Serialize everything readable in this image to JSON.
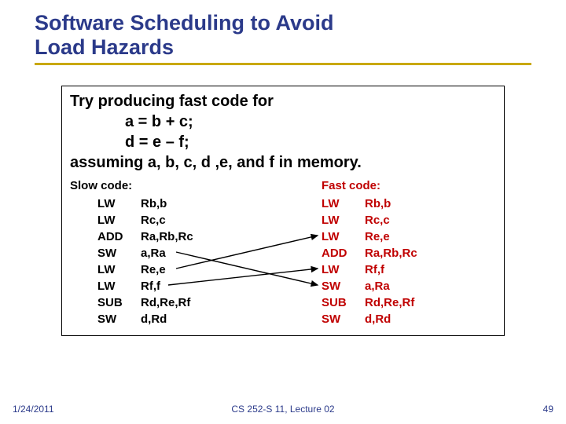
{
  "title_line1": "Software Scheduling to Avoid",
  "title_line2": "Load Hazards",
  "prompt": {
    "line1": "Try producing fast code for",
    "eq1": "a = b + c;",
    "eq2": "d = e – f;",
    "line2": "assuming a, b, c, d ,e, and f in memory."
  },
  "slow_label": "Slow code:",
  "fast_label": "Fast code:",
  "slow": [
    {
      "op": "LW",
      "arg": "Rb,b"
    },
    {
      "op": "LW",
      "arg": "Rc,c"
    },
    {
      "op": "ADD",
      "arg": "Ra,Rb,Rc"
    },
    {
      "op": "SW",
      "arg": "a,Ra"
    },
    {
      "op": "LW",
      "arg": "Re,e"
    },
    {
      "op": "LW",
      "arg": "Rf,f"
    },
    {
      "op": "SUB",
      "arg": "Rd,Re,Rf"
    },
    {
      "op": "SW",
      "arg": "d,Rd"
    }
  ],
  "fast": [
    {
      "op": "LW",
      "arg": "Rb,b"
    },
    {
      "op": "LW",
      "arg": "Rc,c"
    },
    {
      "op": "LW",
      "arg": "Re,e"
    },
    {
      "op": "ADD",
      "arg": "Ra,Rb,Rc"
    },
    {
      "op": "LW",
      "arg": "Rf,f"
    },
    {
      "op": "SW",
      "arg": "a,Ra"
    },
    {
      "op": "SUB",
      "arg": "Rd,Re,Rf"
    },
    {
      "op": "SW",
      "arg": "d,Rd"
    }
  ],
  "footer": {
    "date": "1/24/2011",
    "mid": "CS 252-S 11, Lecture 02",
    "num": "49"
  },
  "chart_data": {
    "type": "table",
    "title": "Instruction reordering: slow vs fast code",
    "series": [
      {
        "name": "Slow code",
        "values": [
          "LW Rb,b",
          "LW Rc,c",
          "ADD Ra,Rb,Rc",
          "SW a,Ra",
          "LW Re,e",
          "LW Rf,f",
          "SUB Rd,Re,Rf",
          "SW d,Rd"
        ]
      },
      {
        "name": "Fast code",
        "values": [
          "LW Rb,b",
          "LW Rc,c",
          "LW Re,e",
          "ADD Ra,Rb,Rc",
          "LW Rf,f",
          "SW a,Ra",
          "SUB Rd,Re,Rf",
          "SW d,Rd"
        ]
      }
    ],
    "arrows": [
      {
        "from": "slow[3] SW a,Ra",
        "to": "fast[5] SW a,Ra"
      },
      {
        "from": "slow[4] LW Re,e",
        "to": "fast[2] LW Re,e"
      },
      {
        "from": "slow[5] LW Rf,f",
        "to": "fast[4] LW Rf,f"
      }
    ]
  }
}
